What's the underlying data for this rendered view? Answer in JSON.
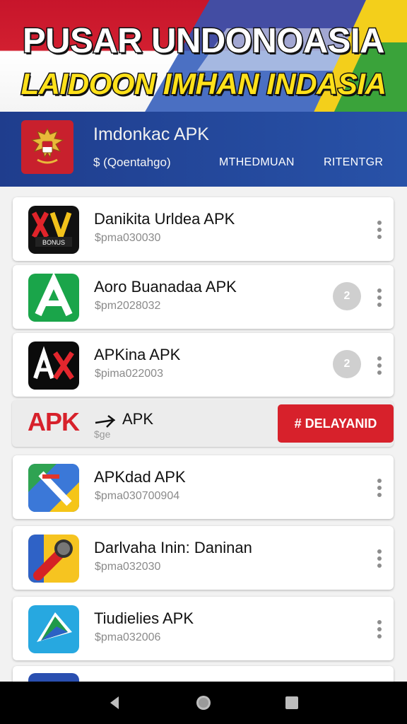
{
  "banner": {
    "line1": "PUSAR UNDONOASIA",
    "line2": "LAIDOON IMHAN INDASIA"
  },
  "header": {
    "title": "Imdonkac APK",
    "subtitle": "$ (Qoentahgo)",
    "links": [
      "MTHEDMUAN",
      "RITENTGR"
    ]
  },
  "apps": [
    {
      "name": "Danikita Urldea APK",
      "meta": "$pma030030",
      "icon": "game-logo-icon"
    },
    {
      "name": "Aoro Buanadaa APK",
      "meta": "$pm2028032",
      "icon": "green-a-icon",
      "badge": "2"
    },
    {
      "name": "APKina APK",
      "meta": "$pima022003",
      "icon": "ax-logo-icon",
      "badge": "2"
    },
    {
      "name": "APKdad APK",
      "meta": "$pma030700904",
      "icon": "maps-style-icon"
    },
    {
      "name": "Darlvaha Inin: Daninan",
      "meta": "$pma032030",
      "icon": "microphone-icon"
    },
    {
      "name": "Tiudielies APK",
      "meta": "$pma032006",
      "icon": "navigation-arrow-icon"
    }
  ],
  "featured": {
    "logo_text": "APK",
    "name": "APK",
    "meta": "$ge",
    "button": "# DELAYANID"
  },
  "colors": {
    "header_blue": "#2852a8",
    "accent_red": "#d7212b",
    "banner_yellow": "#ffe11a"
  }
}
